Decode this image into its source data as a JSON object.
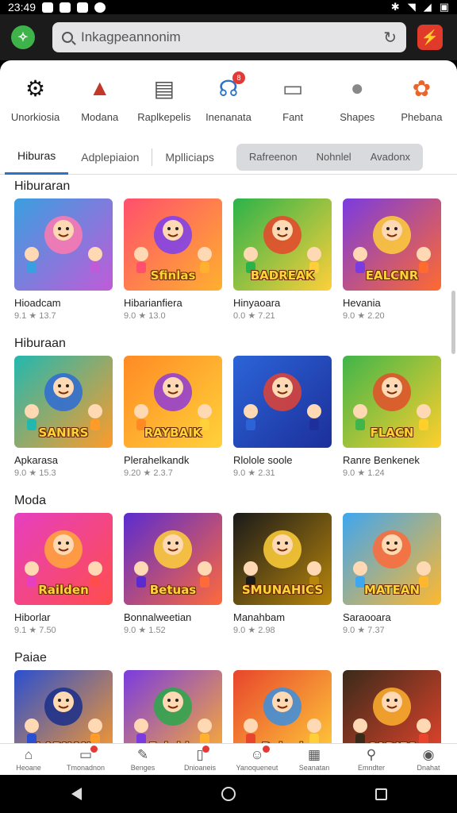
{
  "status_bar": {
    "time": "23:49"
  },
  "search": {
    "value": "Inkagpeannonim"
  },
  "categories": [
    {
      "label": "Unorkiosia",
      "icon": "gear-icon"
    },
    {
      "label": "Modana",
      "icon": "rocket-icon"
    },
    {
      "label": "Raplkepelis",
      "icon": "clipboard-icon"
    },
    {
      "label": "Inenanata",
      "icon": "headset-icon",
      "badge": "8"
    },
    {
      "label": "Fant",
      "icon": "controller-icon"
    },
    {
      "label": "Shapes",
      "icon": "user-icon"
    },
    {
      "label": "Phebana",
      "icon": "mascot-icon"
    }
  ],
  "tabs": {
    "primary": [
      "Hiburas",
      "Adplepiaion",
      "Mplliciaps"
    ],
    "grouped": [
      "Rafreenon",
      "Nohnlel",
      "Avadonx"
    ]
  },
  "sections": [
    {
      "title": "Hiburaran",
      "cards": [
        {
          "title": "Hioadcam",
          "meta": "9.1 ★ 13.7",
          "art": "Hioadcam",
          "thumb_text": "",
          "colors": [
            "#3a9fe0",
            "#c05bd8",
            "#ff7ab0"
          ]
        },
        {
          "title": "Hibarianfiera",
          "meta": "9.0 ★ 13.0",
          "art": "Hibarianfiera",
          "thumb_text": "Sfinlas",
          "colors": [
            "#ff4f6d",
            "#ffb02e",
            "#7b3ff0"
          ]
        },
        {
          "title": "Hinyaoara",
          "meta": "0.0 ★ 7.21",
          "art": "Hinyaoara",
          "thumb_text": "BADREAK",
          "colors": [
            "#2bb34a",
            "#ffcf3a",
            "#e8452c"
          ]
        },
        {
          "title": "Hevania",
          "meta": "9.0 ★ 2.20",
          "art": "Hevania",
          "thumb_text": "EALCNR",
          "colors": [
            "#7a3be0",
            "#ff6a2e",
            "#ffcf3a"
          ]
        }
      ]
    },
    {
      "title": "Hiburaan",
      "cards": [
        {
          "title": "Apkarasa",
          "meta": "9.0 ★ 15.3",
          "art": "Apkarasa",
          "thumb_text": "SANIRS",
          "colors": [
            "#22b8b0",
            "#ff9b28",
            "#2d6bd6"
          ]
        },
        {
          "title": "Plerahelkandk",
          "meta": "9.20 ★ 2.3.7",
          "art": "Plerahelkandk",
          "thumb_text": "RAYBAIK",
          "colors": [
            "#ff8a24",
            "#ffd23a",
            "#8f3bd8"
          ]
        },
        {
          "title": "Rlolole soole",
          "meta": "9.0 ★ 2.31",
          "art": "Rlolole soole",
          "thumb_text": "",
          "colors": [
            "#2c64d8",
            "#1c2f9a",
            "#e24334"
          ]
        },
        {
          "title": "Ranre Benkenek",
          "meta": "9.0 ★ 1.24",
          "art": "Ranre Benkenek",
          "thumb_text": "FLACN",
          "colors": [
            "#3fb54a",
            "#ffcf2c",
            "#e24f2c"
          ]
        }
      ]
    },
    {
      "title": "Moda",
      "cards": [
        {
          "title": "Hiborlar",
          "meta": "9.1 ★ 7.50",
          "art": "Hiborlar",
          "thumb_text": "Railden",
          "colors": [
            "#e63fbf",
            "#ff4d4d",
            "#ffa83a"
          ]
        },
        {
          "title": "Bonnalweetian",
          "meta": "9.0 ★ 1.52",
          "art": "Bonnalweetian",
          "thumb_text": "Betuas",
          "colors": [
            "#5b2bd0",
            "#ff6a3a",
            "#ffd23a"
          ]
        },
        {
          "title": "Manahbam",
          "meta": "9.0 ★ 2.98",
          "art": "Manahbam",
          "thumb_text": "SMUNAHICS",
          "colors": [
            "#1a1a1a",
            "#b8860b",
            "#ffcf3a"
          ]
        },
        {
          "title": "Saraooara",
          "meta": "9.0 ★ 7.37",
          "art": "Saraooara",
          "thumb_text": "MATEAN",
          "colors": [
            "#3fa6f0",
            "#ffb82e",
            "#ff6a3a"
          ]
        }
      ]
    },
    {
      "title": "Paiae",
      "cards": [
        {
          "title": "",
          "meta": "",
          "art": "Labnan",
          "thumb_text": "LABNAN",
          "colors": [
            "#2a4fd0",
            "#ff9b28",
            "#1a2f8a"
          ]
        },
        {
          "title": "",
          "meta": "",
          "art": "Faaide",
          "thumb_text": "Fainide",
          "colors": [
            "#7a3be0",
            "#ffb02e",
            "#2aa84a"
          ]
        },
        {
          "title": "",
          "meta": "",
          "art": "Ruinal",
          "thumb_text": "Rainal",
          "colors": [
            "#e8452c",
            "#ffcf3a",
            "#3a8fe0"
          ]
        },
        {
          "title": "",
          "meta": "",
          "art": "Cadies",
          "thumb_text": "CADIES",
          "colors": [
            "#3a2a1a",
            "#e8452c",
            "#ffb02e"
          ]
        }
      ]
    }
  ],
  "bottom_nav": [
    {
      "label": "Heoane",
      "icon": "home-icon"
    },
    {
      "label": "Tmonadnon",
      "icon": "inbox-icon",
      "dot": true
    },
    {
      "label": "Benges",
      "icon": "edit-icon"
    },
    {
      "label": "Dnioaneis",
      "icon": "bookmark-icon",
      "dot": true
    },
    {
      "label": "Yanoqueneut",
      "icon": "people-icon",
      "dot": true
    },
    {
      "label": "Seanatan",
      "icon": "grid-icon"
    },
    {
      "label": "Emndter",
      "icon": "search-icon"
    },
    {
      "label": "Dnahat",
      "icon": "profile-icon"
    }
  ]
}
